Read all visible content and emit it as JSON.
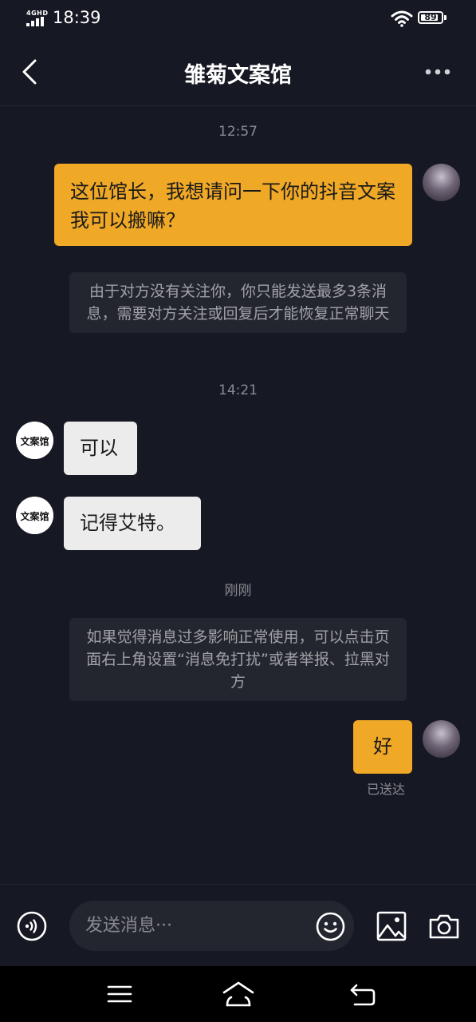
{
  "status_bar": {
    "network": "4GHD",
    "time": "18:39",
    "battery_level": 89,
    "battery_text": "89"
  },
  "header": {
    "title": "雏菊文案馆",
    "back_icon": "chevron-left-icon",
    "more_icon": "more-horizontal-icon"
  },
  "chat": {
    "timestamp_1": "12:57",
    "message_1": {
      "sender": "me",
      "text": "这位馆长，我想请问一下你的抖音文案我可以搬嘛？"
    },
    "system_note_1": "由于对方没有关注你，你只能发送最多3条消息，需要对方关注或回复后才能恢复正常聊天",
    "timestamp_2": "14:21",
    "message_2": {
      "sender": "them",
      "avatar_text": "文案馆",
      "text": "可以"
    },
    "message_3": {
      "sender": "them",
      "avatar_text": "文案馆",
      "text": "记得艾特。"
    },
    "timestamp_3": "刚刚",
    "system_note_2": "如果觉得消息过多影响正常使用，可以点击页面右上角设置“消息免打扰”或者举报、拉黑对方",
    "message_4": {
      "sender": "me",
      "text": "好"
    },
    "status": "已送达"
  },
  "input_bar": {
    "placeholder": "发送消息···",
    "voice_icon": "voice-icon",
    "emoji_icon": "emoji-icon",
    "image_icon": "image-icon",
    "camera_icon": "camera-icon"
  },
  "colors": {
    "background": "#161823",
    "my_bubble": "#f0a827",
    "their_bubble": "#ececed",
    "system_note_bg": "#24262f",
    "muted_text": "#8a8b91"
  }
}
